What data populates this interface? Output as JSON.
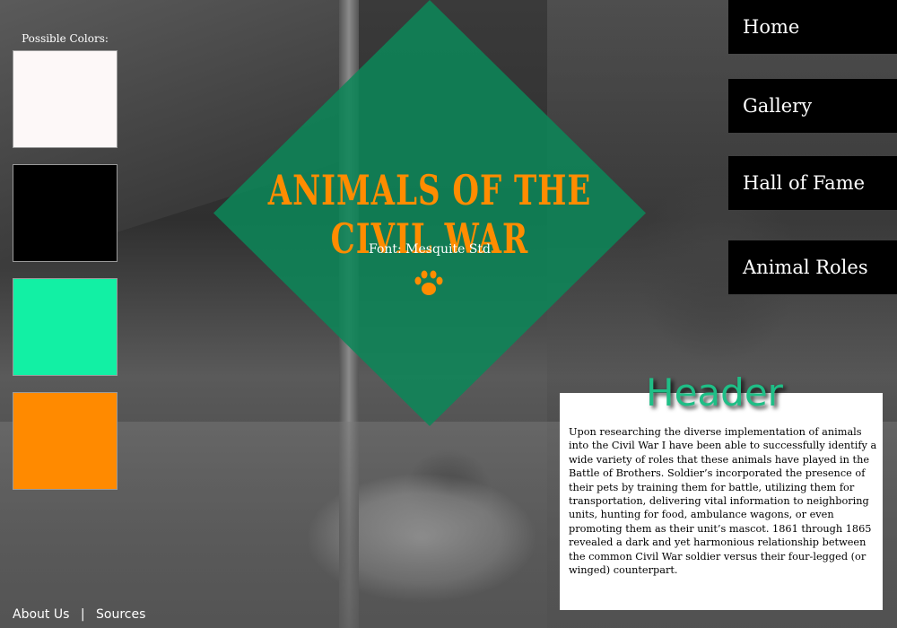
{
  "palette": {
    "title": "Possible Colors:",
    "colors": [
      "#fdf8f8",
      "#000000",
      "#12f0a4",
      "#ff8a00"
    ]
  },
  "hero": {
    "title": "ANIMALS OF THE CIVIL WAR",
    "subtitle": "Font: Mesquite Std",
    "icon": "paw-icon",
    "accent_color": "#ff8c00",
    "diamond_color": "#0c8758"
  },
  "nav": {
    "home": "Home",
    "gallery": "Gallery",
    "hall_of_fame": "Hall of Fame",
    "animal_roles": "Animal Roles"
  },
  "content": {
    "header": "Header",
    "body": "Upon researching the diverse implementation of animals into the Civil War I have been able to successfully identify a wide variety of roles that these animals have played in the Battle of Brothers. Soldier’s incorporated the presence of their pets by training them for battle, utilizing them for transportation, delivering vital information to neighboring units, hunting for food, ambulance wagons, or even promoting them as their unit’s mascot. 1861 through 1865 revealed a dark and yet harmonious relationship between the common Civil War soldier versus their four-legged (or winged) counterpart."
  },
  "footer": {
    "about": "About Us",
    "separator": "|",
    "sources": "Sources"
  }
}
